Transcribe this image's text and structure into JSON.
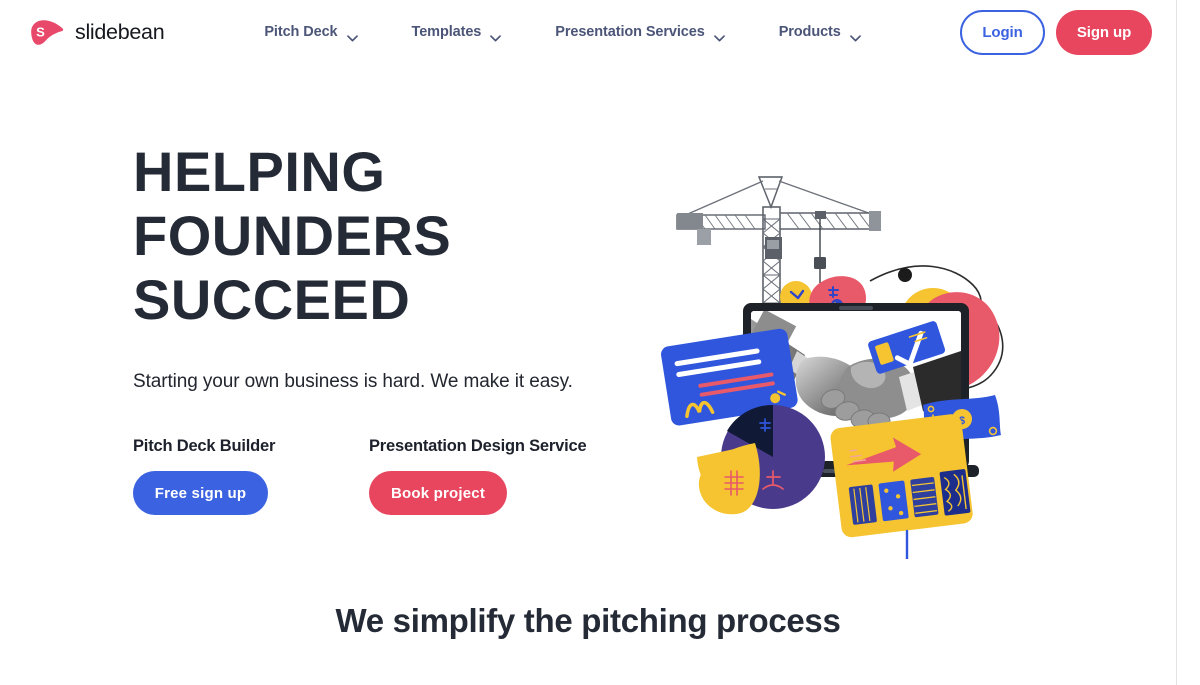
{
  "brand": {
    "name": "slidebean",
    "mark_letter": "S",
    "mark_color": "#e8486a",
    "mark_text_color": "#ffffff"
  },
  "header": {
    "nav": [
      {
        "label": "Pitch Deck",
        "icon": "chevron-down-icon",
        "has_dropdown": true
      },
      {
        "label": "Templates",
        "icon": "chevron-down-icon",
        "has_dropdown": true
      },
      {
        "label": "Presentation Services",
        "icon": "chevron-down-icon",
        "has_dropdown": true
      },
      {
        "label": "Products",
        "icon": "chevron-down-icon",
        "has_dropdown": true
      }
    ],
    "login_label": "Login",
    "signup_label": "Sign up",
    "login_color": "#3b62e0",
    "signup_color": "#e8465f"
  },
  "hero": {
    "title_lines": [
      "HELPING",
      "FOUNDERS",
      "SUCCEED"
    ],
    "subtitle": "Starting your own business is hard. We make it easy.",
    "ctas": [
      {
        "label": "Pitch Deck Builder",
        "button_label": "Free sign up",
        "button_color": "#3b62e0"
      },
      {
        "label": "Presentation Design Service",
        "button_label": "Book project",
        "button_color": "#e8465f"
      }
    ],
    "illustration": {
      "name": "startup-collage-illustration",
      "elements": [
        "construction-crane",
        "laptop-with-handshake-photo",
        "blue-credit-card",
        "pie-chart",
        "red-blob",
        "yellow-circle",
        "yellow-document-card",
        "blue-dollar-bill",
        "yellow-coins",
        "red-tag-blob",
        "blue-check-ticket"
      ],
      "palette": {
        "blue": "#3b62e0",
        "red": "#e8596a",
        "yellow": "#f5c430",
        "purple": "#4a3a8c",
        "navy": "#101935",
        "gray": "#8c9099"
      }
    }
  },
  "next_section": {
    "heading": "We simplify the pitching process"
  }
}
